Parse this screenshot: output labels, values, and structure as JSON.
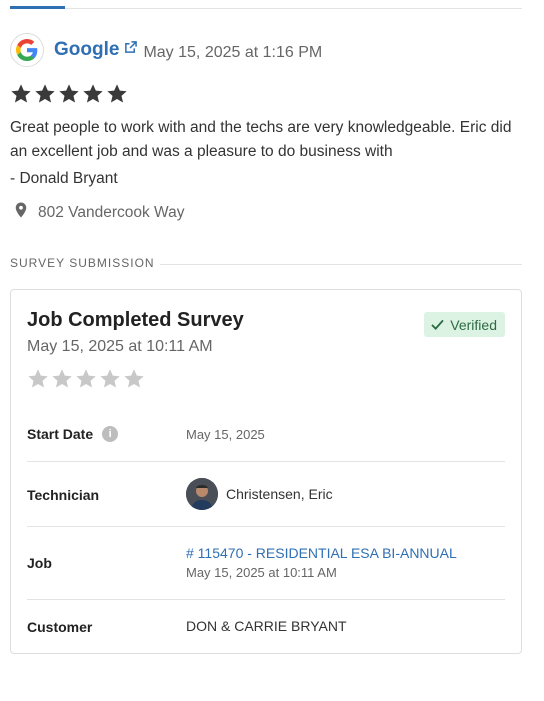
{
  "review": {
    "source": "Google",
    "date": "May 15, 2025 at 1:16 PM",
    "rating": 5,
    "text": "Great people to work with and the techs are very knowledgeable. Eric did an excellent job and was a pleasure to do business with",
    "author": "- Donald Bryant",
    "location": "802 Vandercook Way"
  },
  "section": {
    "label": "SURVEY SUBMISSION"
  },
  "survey": {
    "title": "Job Completed Survey",
    "date": "May 15, 2025 at 10:11 AM",
    "badge": "Verified",
    "rating": 0,
    "start_date_label": "Start Date",
    "start_date_value": "May 15, 2025",
    "technician_label": "Technician",
    "technician_name": "Christensen, Eric",
    "job_label": "Job",
    "job_link": "# 115470 - RESIDENTIAL ESA BI-ANNUAL",
    "job_date": "May 15, 2025 at 10:11 AM",
    "customer_label": "Customer",
    "customer_value": "DON & CARRIE BRYANT"
  },
  "colors": {
    "link": "#2f6fb3",
    "star_filled": "#3a3a3a",
    "star_empty": "#c8c8c8",
    "verified_bg": "#dcf3e3"
  }
}
